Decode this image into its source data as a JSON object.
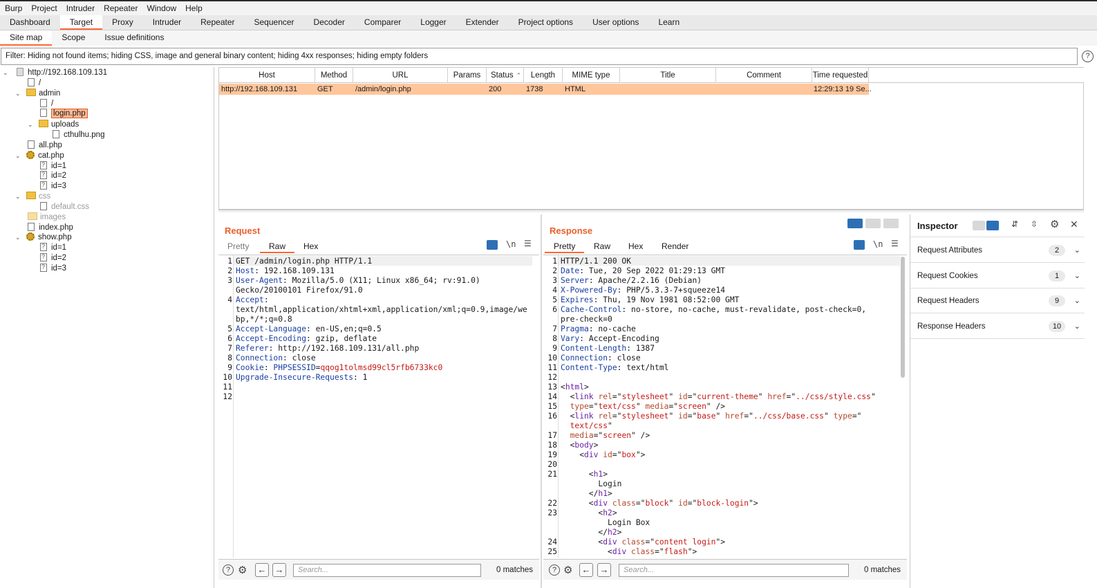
{
  "menu": [
    "Burp",
    "Project",
    "Intruder",
    "Repeater",
    "Window",
    "Help"
  ],
  "tabs": [
    "Dashboard",
    "Target",
    "Proxy",
    "Intruder",
    "Repeater",
    "Sequencer",
    "Decoder",
    "Comparer",
    "Logger",
    "Extender",
    "Project options",
    "User options",
    "Learn"
  ],
  "active_tab": "Target",
  "subtabs": [
    "Site map",
    "Scope",
    "Issue definitions"
  ],
  "filter_text": "Filter: Hiding not found items;  hiding CSS, image and general binary content;  hiding 4xx responses;  hiding empty folders",
  "tree": {
    "host": "http://192.168.109.131",
    "root_slash": "/",
    "admin": "admin",
    "admin_slash": "/",
    "login": "login.php",
    "uploads": "uploads",
    "cthulhu": "cthulhu.png",
    "allphp": "all.php",
    "catphp": "cat.php",
    "cat_id1": "id=1",
    "cat_id2": "id=2",
    "cat_id3": "id=3",
    "css": "css",
    "defaultcss": "default.css",
    "images": "images",
    "indexphp": "index.php",
    "showphp": "show.php",
    "show_id1": "id=1",
    "show_id2": "id=2",
    "show_id3": "id=3"
  },
  "table": {
    "headers": [
      "Host",
      "Method",
      "URL",
      "Params",
      "Status",
      "Length",
      "MIME type",
      "Title",
      "Comment",
      "Time requested"
    ],
    "row": {
      "host": "http://192.168.109.131",
      "method": "GET",
      "url": "/admin/login.php",
      "params": "",
      "status": "200",
      "length": "1738",
      "mime": "HTML",
      "title": "",
      "comment": "",
      "time": "12:29:13 19 Se..."
    }
  },
  "request": {
    "title": "Request",
    "tabs": [
      "Pretty",
      "Raw",
      "Hex"
    ],
    "active_tab": "Raw",
    "lines": [
      {
        "n": "1",
        "name": "",
        "value": "GET /admin/login.php HTTP/1.1"
      },
      {
        "n": "2",
        "name": "Host",
        "value": ": 192.168.109.131"
      },
      {
        "n": "3",
        "name": "User-Agent",
        "value": ": Mozilla/5.0 (X11; Linux x86_64; rv:91.0)"
      },
      {
        "n": "",
        "name": "",
        "value": "Gecko/20100101 Firefox/91.0"
      },
      {
        "n": "4",
        "name": "Accept",
        "value": ":"
      },
      {
        "n": "",
        "name": "",
        "value": "text/html,application/xhtml+xml,application/xml;q=0.9,image/we"
      },
      {
        "n": "",
        "name": "",
        "value": "bp,*/*;q=0.8"
      },
      {
        "n": "5",
        "name": "Accept-Language",
        "value": ": en-US,en;q=0.5"
      },
      {
        "n": "6",
        "name": "Accept-Encoding",
        "value": ": gzip, deflate"
      },
      {
        "n": "7",
        "name": "Referer",
        "value": ": http://192.168.109.131/all.php"
      },
      {
        "n": "8",
        "name": "Connection",
        "value": ": close"
      },
      {
        "n": "9",
        "name": "Cookie",
        "value": ": ",
        "cookie_name": "PHPSESSID",
        "cookie_value": "qqog1tolmsd99cl5rfb6733kc0"
      },
      {
        "n": "10",
        "name": "Upgrade-Insecure-Requests",
        "value": ": 1"
      },
      {
        "n": "11",
        "name": "",
        "value": ""
      },
      {
        "n": "12",
        "name": "",
        "value": ""
      }
    ],
    "search_placeholder": "Search...",
    "matches": "0 matches"
  },
  "response": {
    "title": "Response",
    "tabs": [
      "Pretty",
      "Raw",
      "Hex",
      "Render"
    ],
    "active_tab": "Pretty",
    "search_placeholder": "Search...",
    "matches": "0 matches"
  },
  "inspector": {
    "title": "Inspector",
    "sections": [
      {
        "label": "Request Attributes",
        "count": "2"
      },
      {
        "label": "Request Cookies",
        "count": "1"
      },
      {
        "label": "Request Headers",
        "count": "9"
      },
      {
        "label": "Response Headers",
        "count": "10"
      }
    ]
  },
  "colors": {
    "accent": "#ff6633",
    "selected_row": "#ffc69c",
    "header_name": "#1a3fa0",
    "cookie": "#c41a16",
    "tag": "#6a1fa8"
  }
}
